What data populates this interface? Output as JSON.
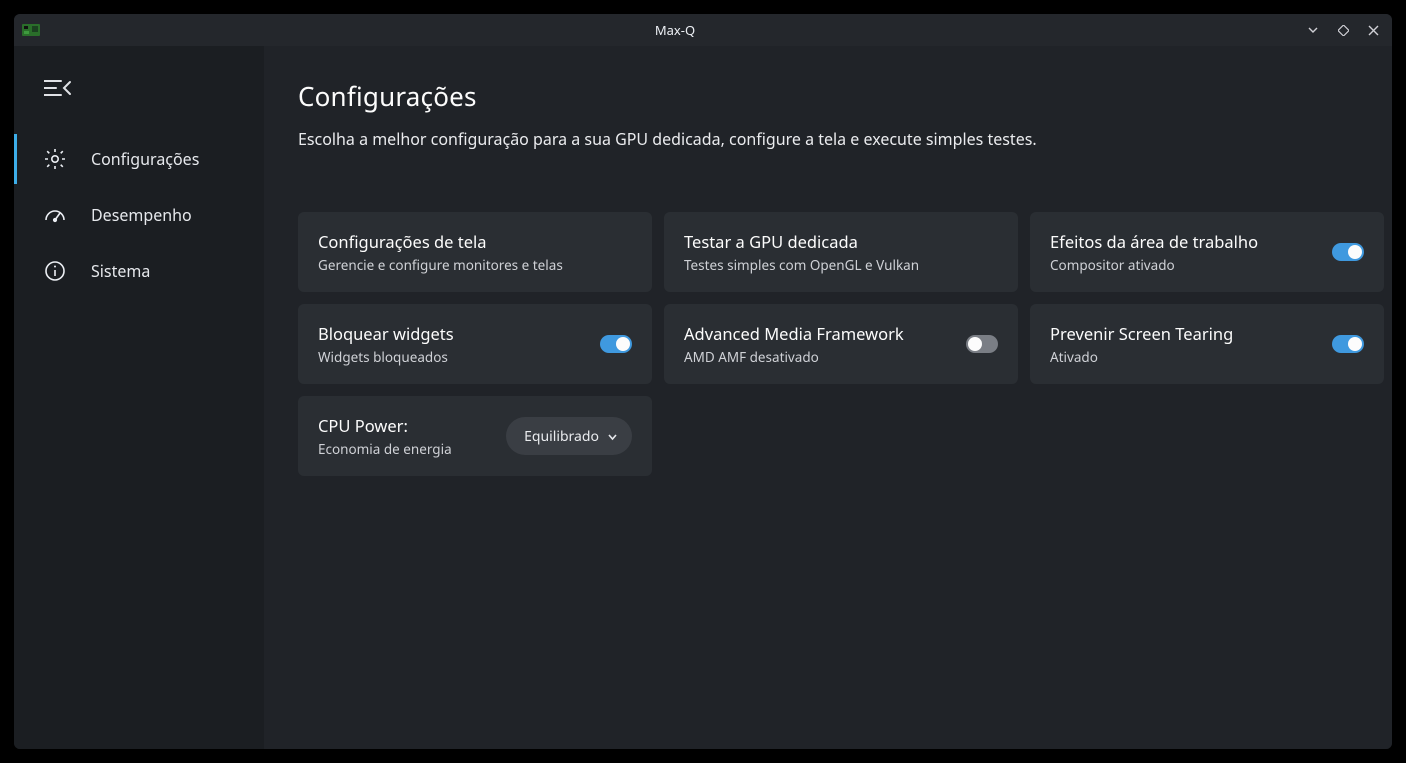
{
  "titlebar": {
    "title": "Max-Q"
  },
  "sidebar": {
    "items": [
      {
        "label": "Configurações"
      },
      {
        "label": "Desempenho"
      },
      {
        "label": "Sistema"
      }
    ]
  },
  "page": {
    "title": "Configurações",
    "subtitle": "Escolha a melhor configuração para a sua GPU dedicada, configure a tela e execute simples testes."
  },
  "cards": {
    "screen": {
      "title": "Configurações de tela",
      "sub": "Gerencie e configure monitores e telas"
    },
    "gputest": {
      "title": "Testar a GPU dedicada",
      "sub": "Testes simples com OpenGL e Vulkan"
    },
    "effects": {
      "title": "Efeitos da área de trabalho",
      "sub": "Compositor ativado"
    },
    "lockwid": {
      "title": "Bloquear widgets",
      "sub": "Widgets bloqueados"
    },
    "amf": {
      "title": "Advanced Media Framework",
      "sub": "AMD AMF desativado"
    },
    "tearing": {
      "title": "Prevenir Screen Tearing",
      "sub": "Ativado"
    },
    "cpupower": {
      "title": "CPU Power:",
      "sub": "Economia de energia",
      "selected": "Equilibrado"
    }
  }
}
